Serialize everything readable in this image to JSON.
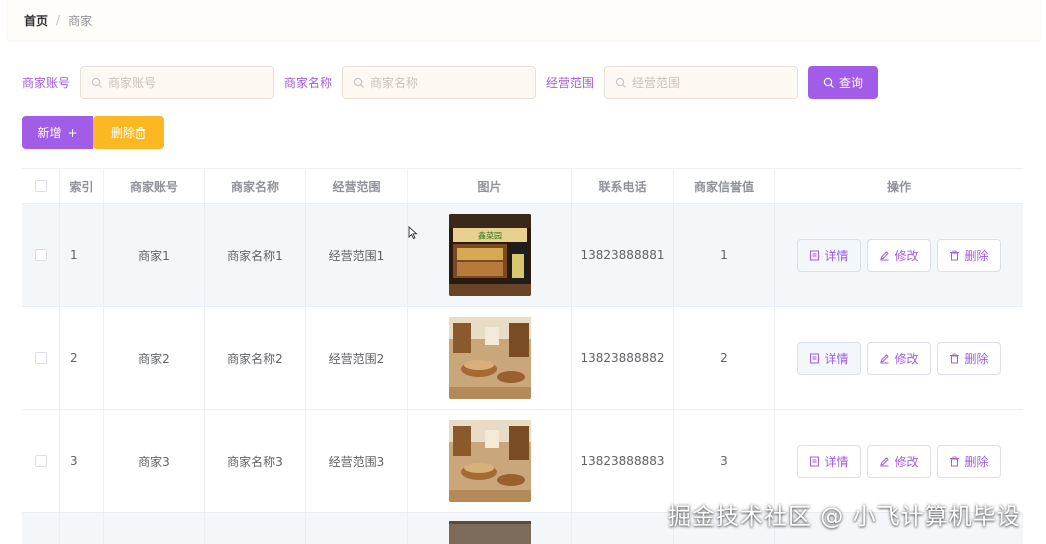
{
  "breadcrumb": {
    "home": "首页",
    "separator": "/",
    "current": "商家"
  },
  "search": {
    "fields": [
      {
        "label": "商家账号",
        "placeholder": "商家账号"
      },
      {
        "label": "商家名称",
        "placeholder": "商家名称"
      },
      {
        "label": "经营范围",
        "placeholder": "经营范围"
      }
    ],
    "query_label": "查询"
  },
  "actions": {
    "add_label": "新增",
    "add_glyph": "+",
    "delete_label": "删除"
  },
  "table": {
    "headers": [
      "索引",
      "商家账号",
      "商家名称",
      "经营范围",
      "图片",
      "联系电话",
      "商家信誉值",
      "操作"
    ],
    "rows": [
      {
        "index": "1",
        "account": "商家1",
        "name": "商家名称1",
        "scope": "经营范围1",
        "image_icon": "storefront-photo",
        "image_sign": "鑫菜园",
        "phone": "13823888881",
        "credit": "1"
      },
      {
        "index": "2",
        "account": "商家2",
        "name": "商家名称2",
        "scope": "经营范围2",
        "image_icon": "shop-interior-photo",
        "phone": "13823888882",
        "credit": "2"
      },
      {
        "index": "3",
        "account": "商家3",
        "name": "商家名称3",
        "scope": "经营范围3",
        "image_icon": "shop-interior-photo",
        "phone": "13823888883",
        "credit": "3"
      }
    ],
    "row_actions": {
      "detail": "详情",
      "edit": "修改",
      "delete": "删除"
    }
  },
  "watermark": "掘金技术社区 @ 小飞计算机毕设",
  "colors": {
    "accent": "#a15ce8",
    "warning": "#fbb822",
    "row_alt": "#f3f7fa"
  }
}
